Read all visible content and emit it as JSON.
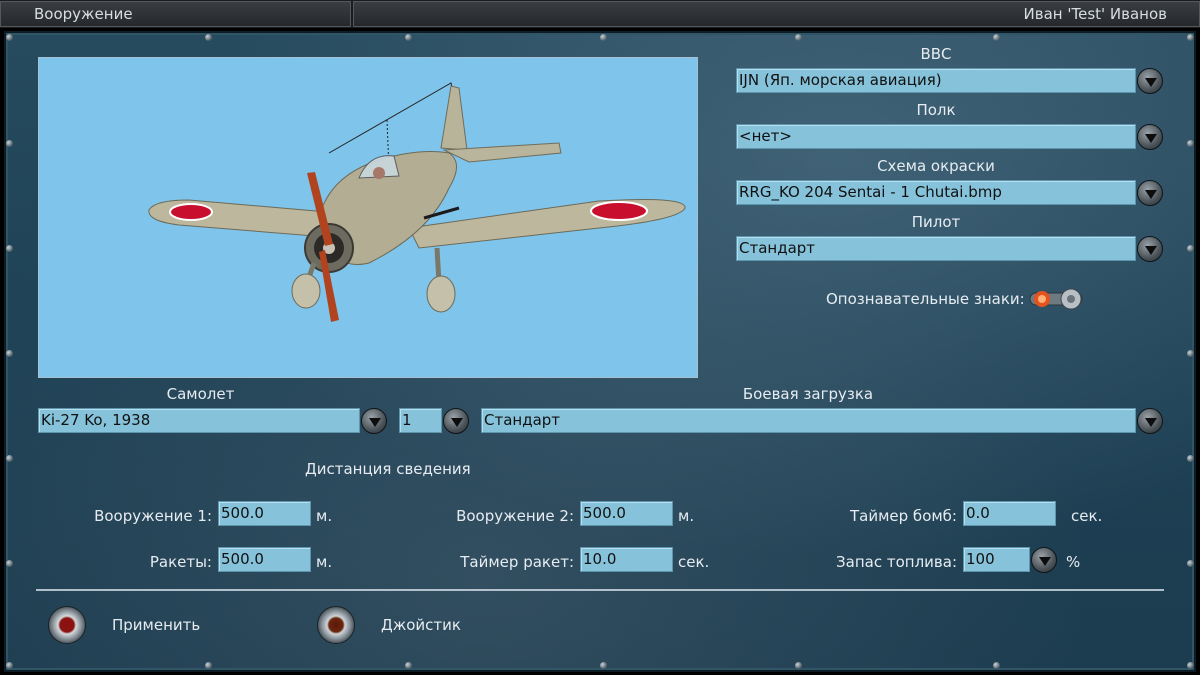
{
  "window": {
    "title": "Вооружение",
    "user": "Иван 'Test' Иванов"
  },
  "preview": {
    "icon": "aircraft-preview-image"
  },
  "air_force": {
    "label": "ВВС",
    "value": "IJN  (Яп. морская авиация)"
  },
  "regiment": {
    "label": "Полк",
    "value": "<нет>"
  },
  "skin": {
    "label": "Схема окраски",
    "value": "RRG_KO 204 Sentai - 1 Chutai.bmp"
  },
  "pilot": {
    "label": "Пилот",
    "value": "Стандарт"
  },
  "markings": {
    "label": "Опознавательные знаки:",
    "state": "on"
  },
  "aircraft": {
    "label": "Самолет",
    "value": "Ki-27 Ko, 1938",
    "count": "1"
  },
  "loadout": {
    "label": "Боевая загрузка",
    "value": "Стандарт"
  },
  "convergence": {
    "heading": "Дистанция сведения",
    "weapon1_label": "Вооружение 1:",
    "weapon1_value": "500.0",
    "weapon1_unit": "м.",
    "weapon2_label": "Вооружение 2:",
    "weapon2_value": "500.0",
    "weapon2_unit": "м.",
    "bomb_timer_label": "Таймер бомб:",
    "bomb_timer_value": "0.0",
    "bomb_timer_unit": "сек.",
    "rockets_label": "Ракеты:",
    "rockets_value": "500.0",
    "rockets_unit": "м.",
    "rocket_timer_label": "Таймер ракет:",
    "rocket_timer_value": "10.0",
    "rocket_timer_unit": "сек.",
    "fuel_label": "Запас топлива:",
    "fuel_value": "100",
    "fuel_unit": "%"
  },
  "buttons": {
    "apply": "Применить",
    "joystick": "Джойстик"
  }
}
